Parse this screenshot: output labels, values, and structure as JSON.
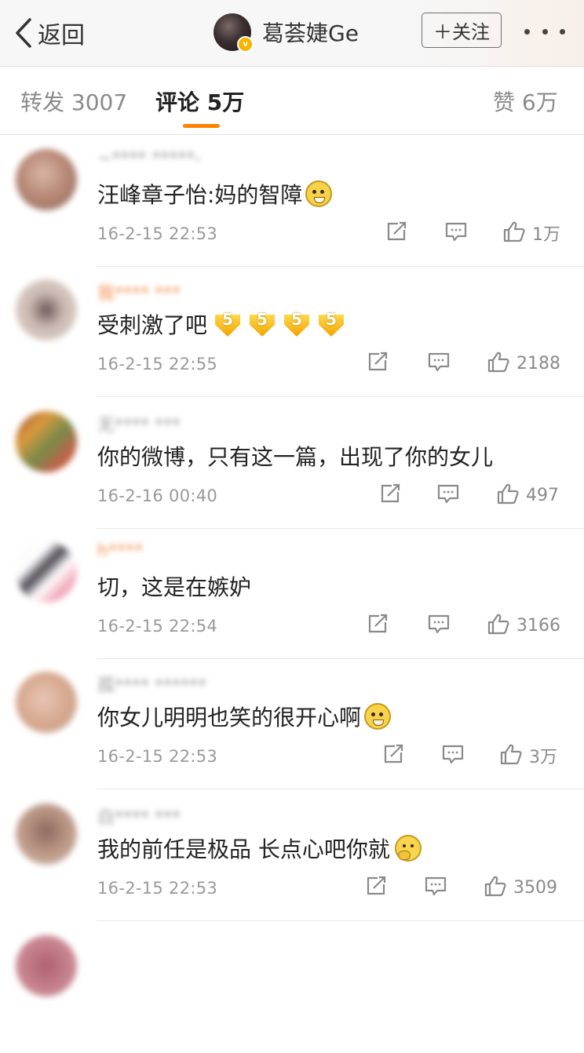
{
  "nav": {
    "back_label": "返回",
    "author_name": "葛荟婕Ge",
    "follow_label": "＋关注",
    "more_icon": "more-dots-icon"
  },
  "tabs": {
    "repost": "转发 3007",
    "comment": "评论 5万",
    "like": "赞 6万",
    "active": "comment",
    "accent": "#ff8200"
  },
  "comments": [
    {
      "user": "~**** *****-",
      "text": "汪峰章子怡:妈的智障",
      "emoji": "doge",
      "time": "16-2-15 22:53",
      "likes": "1万",
      "name_color": "#9a9a9a"
    },
    {
      "user": "我**** ***",
      "text": "受刺激了吧",
      "emoji": "five-arrows",
      "time": "16-2-15 22:55",
      "likes": "2188",
      "name_color": "#f28a4a"
    },
    {
      "user": "无**** ***",
      "text": "你的微博，只有这一篇，出现了你的女儿",
      "emoji": "",
      "time": "16-2-16 00:40",
      "likes": "497",
      "name_color": "#9a9a9a"
    },
    {
      "user": "h****",
      "text": "切，这是在嫉妒",
      "emoji": "",
      "time": "16-2-15 22:54",
      "likes": "3166",
      "name_color": "#f28a4a"
    },
    {
      "user": "孤**** ******",
      "text": "你女儿明明也笑的很开心啊",
      "emoji": "doge",
      "time": "16-2-15 22:53",
      "likes": "3万",
      "name_color": "#9a9a9a"
    },
    {
      "user": "白**** ***",
      "text": "我的前任是极品 长点心吧你就",
      "emoji": "think",
      "time": "16-2-15 22:53",
      "likes": "3509",
      "name_color": "#9a9a9a"
    }
  ],
  "icons": {
    "repost": "share-square-icon",
    "reply": "comment-bubble-icon",
    "like": "thumbs-up-icon"
  }
}
